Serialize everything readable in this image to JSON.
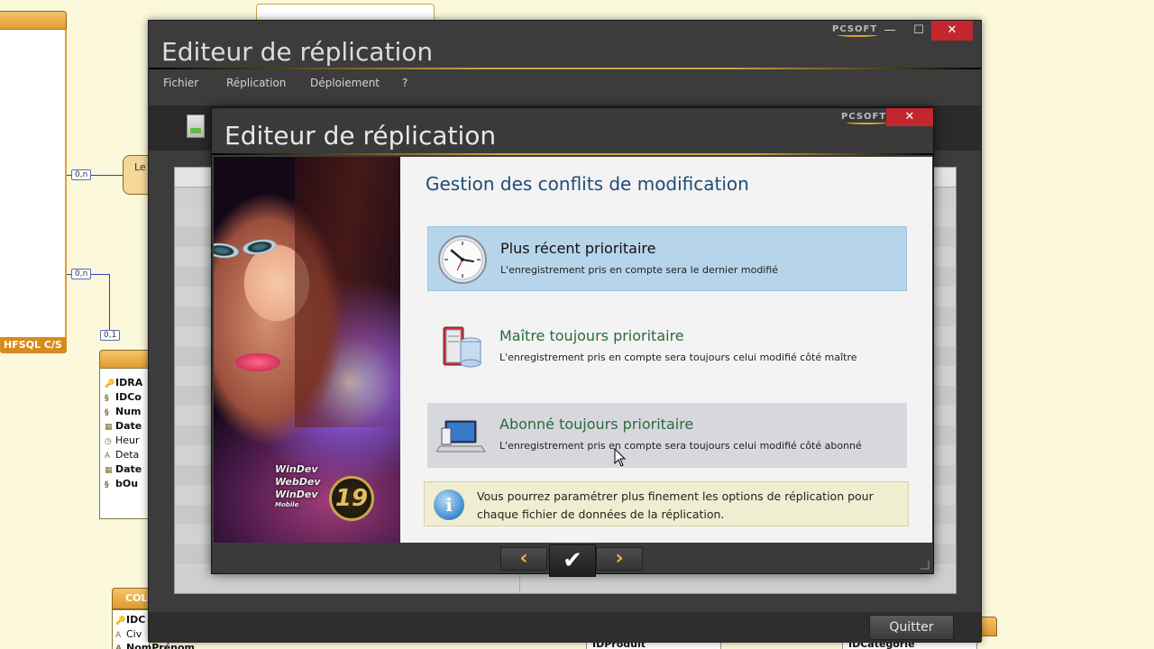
{
  "background": {
    "table_label": "HFSQL C/S",
    "cardinalities": [
      "0,n",
      "0,n",
      "0,1"
    ],
    "relation_text": "Le",
    "fields": [
      {
        "icon": "key",
        "name": "IDRA"
      },
      {
        "icon": "link",
        "name": "IDCo"
      },
      {
        "icon": "link",
        "name": "Num"
      },
      {
        "icon": "date",
        "name": "Date"
      },
      {
        "icon": "clock",
        "name": "Heur"
      },
      {
        "icon": "text",
        "name": "Deta"
      },
      {
        "icon": "date",
        "name": "Date"
      },
      {
        "icon": "link",
        "name": "bOu"
      }
    ],
    "bottom_labels": [
      "COL",
      "IDC",
      "Civ",
      "NomPrénom",
      "IDProduit",
      "IDCatégorie"
    ]
  },
  "outer_window": {
    "title": "Editeur de réplication",
    "brand": "PCSOFT",
    "controls": {
      "minimize": "—",
      "maximize": "☐",
      "close": "✕"
    },
    "menu": [
      "Fichier",
      "Réplication",
      "Déploiement",
      "?"
    ],
    "quit_label": "Quitter"
  },
  "dialog": {
    "title": "Editeur de réplication",
    "brand": "PCSOFT",
    "close": "✕",
    "poster": {
      "brand_lines": [
        "WinDev",
        "WebDev",
        "WinDev"
      ],
      "brand_sub": "Mobile",
      "version": "19"
    },
    "heading": "Gestion des conflits de modification",
    "options": [
      {
        "title": "Plus récent prioritaire",
        "description": "L'enregistrement pris en compte sera le dernier modifié",
        "icon": "clock-icon",
        "state": "selected"
      },
      {
        "title": "Maître toujours prioritaire",
        "description": "L'enregistrement pris en compte sera toujours celui modifié côté maître",
        "icon": "server-icon",
        "state": "normal"
      },
      {
        "title": "Abonné toujours prioritaire",
        "description": "L'enregistrement pris en compte sera toujours celui modifié côté abonné",
        "icon": "laptop-icon",
        "state": "hover"
      }
    ],
    "info": {
      "icon": "info-icon",
      "text": "Vous pourrez paramétrer plus finement les options de réplication pour chaque fichier de données de la réplication."
    },
    "nav": {
      "prev": "‹",
      "ok": "✔",
      "next": "›"
    }
  }
}
